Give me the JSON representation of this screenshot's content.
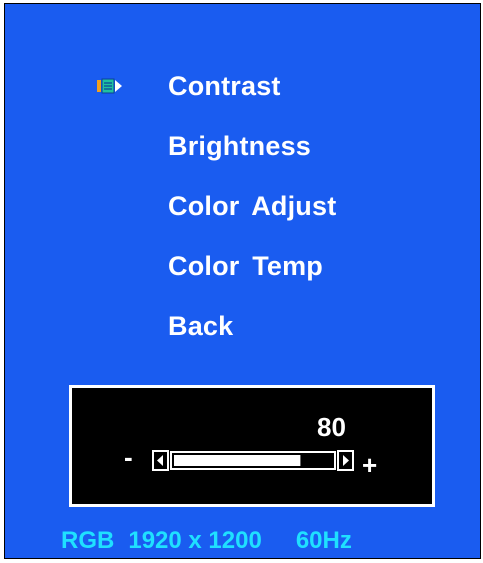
{
  "menu": {
    "items": [
      {
        "label": "Contrast",
        "selected": true
      },
      {
        "label": "Brightness",
        "selected": false
      },
      {
        "label": "Color  Adjust",
        "selected": false
      },
      {
        "label": "Color  Temp",
        "selected": false
      },
      {
        "label": "Back",
        "selected": false
      }
    ],
    "selector_icon": "selection-arrow-icon"
  },
  "adjustment": {
    "value": "80",
    "minus_label": "-",
    "plus_label": "+",
    "level_fraction": 0.8,
    "left_arrow_icon": "slider-left-arrow-icon",
    "right_arrow_icon": "slider-right-arrow-icon"
  },
  "status": {
    "signal": "RGB",
    "resolution": "1920 x 1200",
    "refresh_rate": "60Hz"
  },
  "colors": {
    "background": "#1a5cf0",
    "text": "#ffffff",
    "status_text": "#1fe0ff",
    "value_box": "#000000"
  }
}
